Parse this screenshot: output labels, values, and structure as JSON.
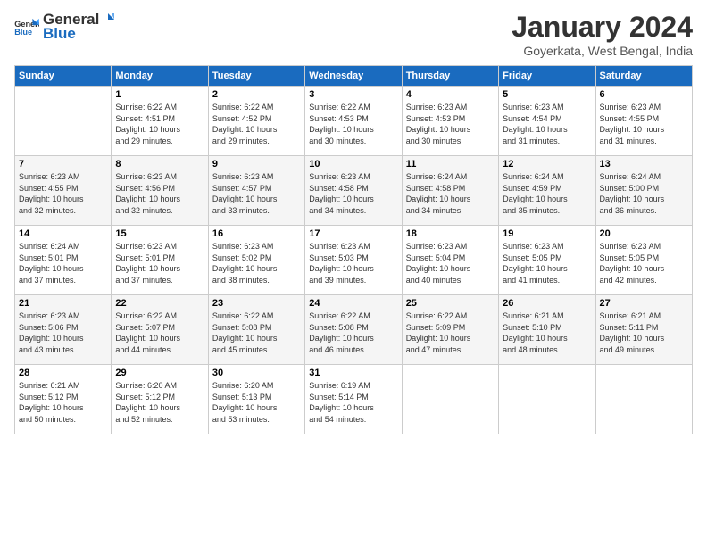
{
  "logo": {
    "general": "General",
    "blue": "Blue"
  },
  "header": {
    "title": "January 2024",
    "subtitle": "Goyerkata, West Bengal, India"
  },
  "columns": [
    "Sunday",
    "Monday",
    "Tuesday",
    "Wednesday",
    "Thursday",
    "Friday",
    "Saturday"
  ],
  "weeks": [
    [
      {
        "day": "",
        "info": ""
      },
      {
        "day": "1",
        "info": "Sunrise: 6:22 AM\nSunset: 4:51 PM\nDaylight: 10 hours\nand 29 minutes."
      },
      {
        "day": "2",
        "info": "Sunrise: 6:22 AM\nSunset: 4:52 PM\nDaylight: 10 hours\nand 29 minutes."
      },
      {
        "day": "3",
        "info": "Sunrise: 6:22 AM\nSunset: 4:53 PM\nDaylight: 10 hours\nand 30 minutes."
      },
      {
        "day": "4",
        "info": "Sunrise: 6:23 AM\nSunset: 4:53 PM\nDaylight: 10 hours\nand 30 minutes."
      },
      {
        "day": "5",
        "info": "Sunrise: 6:23 AM\nSunset: 4:54 PM\nDaylight: 10 hours\nand 31 minutes."
      },
      {
        "day": "6",
        "info": "Sunrise: 6:23 AM\nSunset: 4:55 PM\nDaylight: 10 hours\nand 31 minutes."
      }
    ],
    [
      {
        "day": "7",
        "info": "Sunrise: 6:23 AM\nSunset: 4:55 PM\nDaylight: 10 hours\nand 32 minutes."
      },
      {
        "day": "8",
        "info": "Sunrise: 6:23 AM\nSunset: 4:56 PM\nDaylight: 10 hours\nand 32 minutes."
      },
      {
        "day": "9",
        "info": "Sunrise: 6:23 AM\nSunset: 4:57 PM\nDaylight: 10 hours\nand 33 minutes."
      },
      {
        "day": "10",
        "info": "Sunrise: 6:23 AM\nSunset: 4:58 PM\nDaylight: 10 hours\nand 34 minutes."
      },
      {
        "day": "11",
        "info": "Sunrise: 6:24 AM\nSunset: 4:58 PM\nDaylight: 10 hours\nand 34 minutes."
      },
      {
        "day": "12",
        "info": "Sunrise: 6:24 AM\nSunset: 4:59 PM\nDaylight: 10 hours\nand 35 minutes."
      },
      {
        "day": "13",
        "info": "Sunrise: 6:24 AM\nSunset: 5:00 PM\nDaylight: 10 hours\nand 36 minutes."
      }
    ],
    [
      {
        "day": "14",
        "info": "Sunrise: 6:24 AM\nSunset: 5:01 PM\nDaylight: 10 hours\nand 37 minutes."
      },
      {
        "day": "15",
        "info": "Sunrise: 6:23 AM\nSunset: 5:01 PM\nDaylight: 10 hours\nand 37 minutes."
      },
      {
        "day": "16",
        "info": "Sunrise: 6:23 AM\nSunset: 5:02 PM\nDaylight: 10 hours\nand 38 minutes."
      },
      {
        "day": "17",
        "info": "Sunrise: 6:23 AM\nSunset: 5:03 PM\nDaylight: 10 hours\nand 39 minutes."
      },
      {
        "day": "18",
        "info": "Sunrise: 6:23 AM\nSunset: 5:04 PM\nDaylight: 10 hours\nand 40 minutes."
      },
      {
        "day": "19",
        "info": "Sunrise: 6:23 AM\nSunset: 5:05 PM\nDaylight: 10 hours\nand 41 minutes."
      },
      {
        "day": "20",
        "info": "Sunrise: 6:23 AM\nSunset: 5:05 PM\nDaylight: 10 hours\nand 42 minutes."
      }
    ],
    [
      {
        "day": "21",
        "info": "Sunrise: 6:23 AM\nSunset: 5:06 PM\nDaylight: 10 hours\nand 43 minutes."
      },
      {
        "day": "22",
        "info": "Sunrise: 6:22 AM\nSunset: 5:07 PM\nDaylight: 10 hours\nand 44 minutes."
      },
      {
        "day": "23",
        "info": "Sunrise: 6:22 AM\nSunset: 5:08 PM\nDaylight: 10 hours\nand 45 minutes."
      },
      {
        "day": "24",
        "info": "Sunrise: 6:22 AM\nSunset: 5:08 PM\nDaylight: 10 hours\nand 46 minutes."
      },
      {
        "day": "25",
        "info": "Sunrise: 6:22 AM\nSunset: 5:09 PM\nDaylight: 10 hours\nand 47 minutes."
      },
      {
        "day": "26",
        "info": "Sunrise: 6:21 AM\nSunset: 5:10 PM\nDaylight: 10 hours\nand 48 minutes."
      },
      {
        "day": "27",
        "info": "Sunrise: 6:21 AM\nSunset: 5:11 PM\nDaylight: 10 hours\nand 49 minutes."
      }
    ],
    [
      {
        "day": "28",
        "info": "Sunrise: 6:21 AM\nSunset: 5:12 PM\nDaylight: 10 hours\nand 50 minutes."
      },
      {
        "day": "29",
        "info": "Sunrise: 6:20 AM\nSunset: 5:12 PM\nDaylight: 10 hours\nand 52 minutes."
      },
      {
        "day": "30",
        "info": "Sunrise: 6:20 AM\nSunset: 5:13 PM\nDaylight: 10 hours\nand 53 minutes."
      },
      {
        "day": "31",
        "info": "Sunrise: 6:19 AM\nSunset: 5:14 PM\nDaylight: 10 hours\nand 54 minutes."
      },
      {
        "day": "",
        "info": ""
      },
      {
        "day": "",
        "info": ""
      },
      {
        "day": "",
        "info": ""
      }
    ]
  ]
}
